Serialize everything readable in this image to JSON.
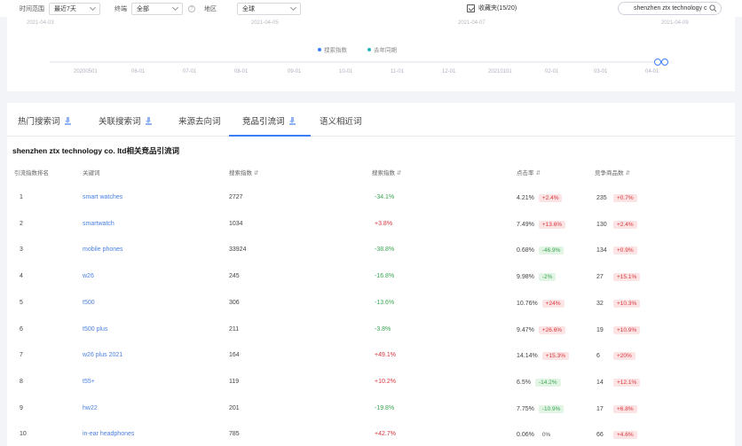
{
  "filters": {
    "time_label": "时间范围",
    "time_value": "最近7天",
    "channel_label": "终端",
    "channel_value": "全部",
    "region_label": "地区",
    "region_value": "全球"
  },
  "collect": {
    "label": "收藏夹(15/20)"
  },
  "search": {
    "value": "shenzhen ztx technology c"
  },
  "chart": {
    "top_dates": [
      "2021-04-03",
      "2021-04-05",
      "2021-04-07",
      "2021-04-09"
    ],
    "legend": [
      {
        "name": "搜索指数",
        "color": "#3c7ef6"
      },
      {
        "name": "去年同期",
        "color": "#2bb3c0"
      }
    ],
    "slider_ticks": [
      "20200501",
      "06-01",
      "07-01",
      "08-01",
      "09-01",
      "10-01",
      "11-01",
      "12-01",
      "20210101",
      "02-01",
      "03-01",
      "04-01"
    ]
  },
  "tabs": [
    {
      "label": "热门搜索词",
      "download": true
    },
    {
      "label": "关联搜索词",
      "download": true
    },
    {
      "label": "来源去向词",
      "download": false
    },
    {
      "label": "竞品引流词",
      "download": true
    },
    {
      "label": "语义相近词",
      "download": false
    }
  ],
  "section_title": "shenzhen ztx technology co. ltd相关竞品引流词",
  "table": {
    "headers": [
      "引流指数排名",
      "关键词",
      "搜索指数",
      "搜索指数",
      "点击率",
      "竞争商品数"
    ],
    "rows": [
      {
        "rank": "1",
        "keyword": "smart watches",
        "index": "2727",
        "change": "-34.1%",
        "ctr": "4.21%",
        "ctr_change": "+2.4%",
        "comp": "235",
        "comp_change": "+0.7%"
      },
      {
        "rank": "2",
        "keyword": "smartwatch",
        "index": "1034",
        "change": "+3.8%",
        "ctr": "7.49%",
        "ctr_change": "+13.6%",
        "comp": "130",
        "comp_change": "+2.4%"
      },
      {
        "rank": "3",
        "keyword": "mobile phones",
        "index": "33924",
        "change": "-38.8%",
        "ctr": "0.68%",
        "ctr_change": "-46.9%",
        "comp": "134",
        "comp_change": "+0.9%"
      },
      {
        "rank": "4",
        "keyword": "w26",
        "index": "245",
        "change": "-16.8%",
        "ctr": "9.98%",
        "ctr_change": "-2%",
        "comp": "27",
        "comp_change": "+15.1%"
      },
      {
        "rank": "5",
        "keyword": "t500",
        "index": "306",
        "change": "-13.6%",
        "ctr": "10.76%",
        "ctr_change": "+24%",
        "comp": "32",
        "comp_change": "+10.3%"
      },
      {
        "rank": "6",
        "keyword": "t500 plus",
        "index": "211",
        "change": "-3.8%",
        "ctr": "9.47%",
        "ctr_change": "+26.6%",
        "comp": "19",
        "comp_change": "+10.9%"
      },
      {
        "rank": "7",
        "keyword": "w26 plus 2021",
        "index": "164",
        "change": "+49.1%",
        "ctr": "14.14%",
        "ctr_change": "+15.3%",
        "comp": "6",
        "comp_change": "+20%"
      },
      {
        "rank": "8",
        "keyword": "t55+",
        "index": "119",
        "change": "+10.2%",
        "ctr": "6.5%",
        "ctr_change": "-14.2%",
        "comp": "14",
        "comp_change": "+12.1%"
      },
      {
        "rank": "9",
        "keyword": "hw22",
        "index": "201",
        "change": "-19.8%",
        "ctr": "7.75%",
        "ctr_change": "-10.9%",
        "comp": "17",
        "comp_change": "+6.8%"
      },
      {
        "rank": "10",
        "keyword": "in-ear headphones",
        "index": "785",
        "change": "+42.7%",
        "ctr": "0.06%",
        "ctr_change": "0%",
        "comp": "66",
        "comp_change": "+4.6%"
      }
    ]
  }
}
